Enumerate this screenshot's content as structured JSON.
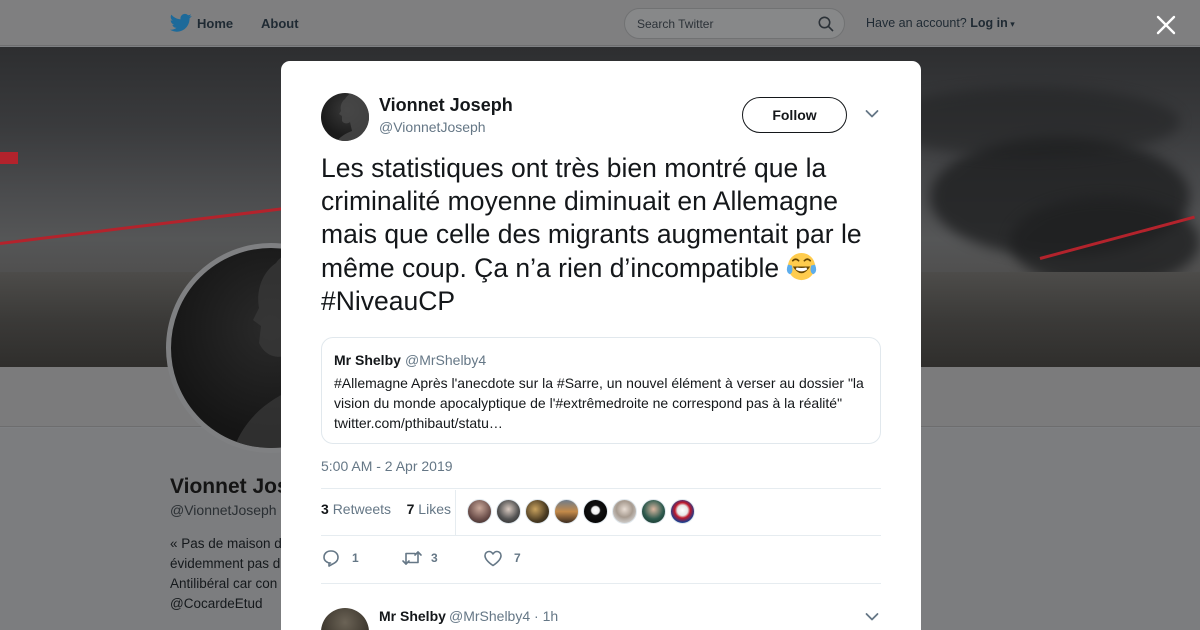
{
  "nav": {
    "home_label": "Home",
    "about_label": "About",
    "search_placeholder": "Search Twitter",
    "account_prompt": "Have an account?",
    "login_label": "Log in"
  },
  "profile": {
    "name": "Vionnet Joseph",
    "handle": "@VionnetJoseph",
    "bio_lines": [
      "« Pas de maison d",
      "évidemment pas d",
      "Antilibéral car con",
      "@CocardeEtud"
    ]
  },
  "tweet": {
    "author_name": "Vionnet Joseph",
    "author_handle": "@VionnetJoseph",
    "follow_label": "Follow",
    "text_main": "Les statistiques ont très bien montré que la criminalité moyenne diminuait en Allemagne mais que celle des migrants augmentait par le même coup. Ça n’a rien d’incompatible",
    "text_hashtag": "#NiveauCP",
    "emoji": "face-with-tears-of-joy",
    "timestamp": "5:00 AM - 2 Apr 2019",
    "retweets_count": "3",
    "retweets_label": "Retweets",
    "likes_count": "7",
    "likes_label": "Likes",
    "likers_count": 8,
    "actions": {
      "reply_count": "1",
      "retweet_count": "3",
      "like_count": "7"
    }
  },
  "quoted_tweet": {
    "author_name": "Mr Shelby",
    "author_handle": "@MrShelby4",
    "text": "#Allemagne Après l'anecdote sur la #Sarre, un nouvel élément à verser au dossier \"la vision du monde apocalyptique de l'#extrêmedroite ne correspond pas à la réalité\" twitter.com/pthibaut/statu…"
  },
  "reply": {
    "author_name": "Mr Shelby",
    "author_handle": "@MrShelby4 · 1h"
  },
  "colors": {
    "twitter_blue": "#1da1f2",
    "secondary_text": "#657786",
    "primary_text": "#14171a"
  }
}
